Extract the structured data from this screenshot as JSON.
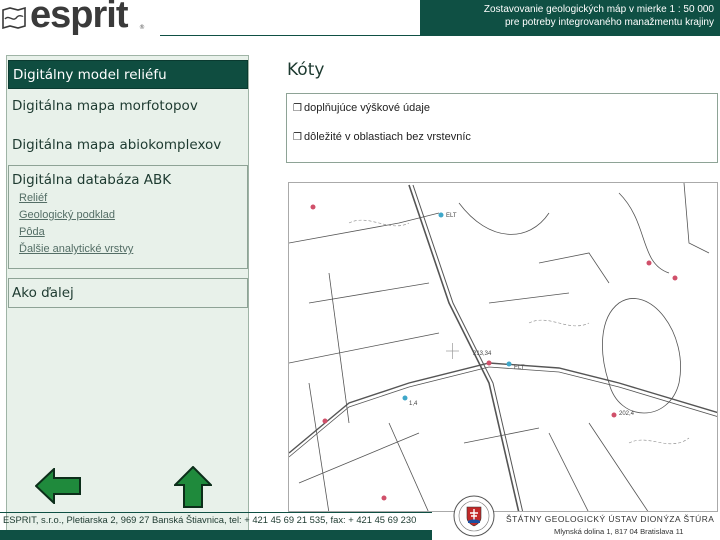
{
  "header": {
    "logo_text": "esprit",
    "logo_reg": "®",
    "title_line1": "Zostavovanie geologických máp v mierke 1 : 50 000",
    "title_line2": "pre potreby integrovaného manažmentu krajiny"
  },
  "sidebar": {
    "items": [
      {
        "label": "Digitálny model reliéfu",
        "active": true
      },
      {
        "label": "Digitálna mapa morfotopov"
      },
      {
        "label": "Digitálna mapa abiokomplexov"
      },
      {
        "label": "Digitálna databáza ABK"
      },
      {
        "label": "Ako ďalej"
      }
    ],
    "subitems": [
      "Reliéf",
      "Geologický podklad",
      "Pôda",
      "Ďalšie analytické vrstvy"
    ]
  },
  "main": {
    "title": "Kóty",
    "bullets": [
      "doplňujúce výškové údaje",
      "dôležité v oblastiach bez vrstevníc"
    ],
    "map_labels": [
      "ELT",
      "213,34",
      "202,4",
      "1,4",
      "ELT"
    ]
  },
  "footer": {
    "contact": "ESPRIT, s.r.o., Pletiarska 2, 969 27 Banská Štiavnica, tel: + 421 45 69 21 535, fax: + 421 45 69 230",
    "sgu_name": "ŠTÁTNY GEOLOGICKÝ ÚSTAV DIONÝZA ŠTÚRA",
    "sgu_address": "Mlynská dolina 1, 817 04 Bratislava 11"
  },
  "colors": {
    "brand_dark_green": "#0f5044",
    "sidebar_bg": "#e8f1ea",
    "arrow_green": "#1f8a3c"
  },
  "icons": [
    "map-fold-icon",
    "prev-arrow-icon",
    "next-arrow-icon",
    "checkbox-bullet-icon",
    "sgu-seal-icon"
  ]
}
